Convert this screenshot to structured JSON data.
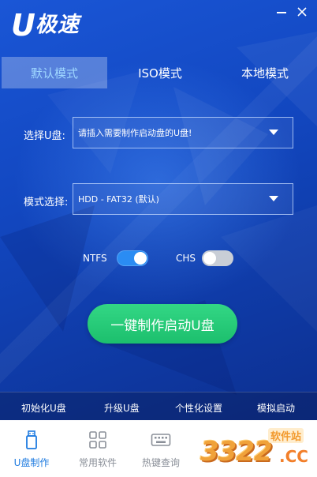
{
  "app": {
    "logo_text": "极速",
    "logo_letter": "U",
    "icons": {
      "minimize": "minimize-icon",
      "close": "close-icon"
    }
  },
  "tabs": [
    {
      "label": "默认模式",
      "active": true
    },
    {
      "label": "ISO模式",
      "active": false
    },
    {
      "label": "本地模式",
      "active": false
    }
  ],
  "form": {
    "usb_select": {
      "label": "选择U盘:",
      "value": "请插入需要制作启动盘的U盘!"
    },
    "mode_select": {
      "label": "模式选择:",
      "value": "HDD - FAT32 (默认)"
    }
  },
  "toggles": [
    {
      "label": "NTFS",
      "on": true
    },
    {
      "label": "CHS",
      "on": false
    }
  ],
  "primary_button": {
    "label": "一键制作启动U盘"
  },
  "toolbar": {
    "items": [
      "初始化U盘",
      "升级U盘",
      "个性化设置",
      "模拟启动"
    ]
  },
  "bottom_nav": {
    "items": [
      {
        "label": "U盘制作",
        "icon": "usb-drive-icon",
        "active": true
      },
      {
        "label": "常用软件",
        "icon": "apps-grid-icon",
        "active": false
      },
      {
        "label": "热键查询",
        "icon": "keyboard-icon",
        "active": false
      }
    ]
  },
  "watermark": {
    "number": "3322",
    "site": "软件站",
    "domain": ".CC"
  },
  "colors": {
    "accent_blue": "#1e7be0",
    "primary_green": "#22c774",
    "toggle_on": "#2a8cf3",
    "background": "#1247c0"
  }
}
